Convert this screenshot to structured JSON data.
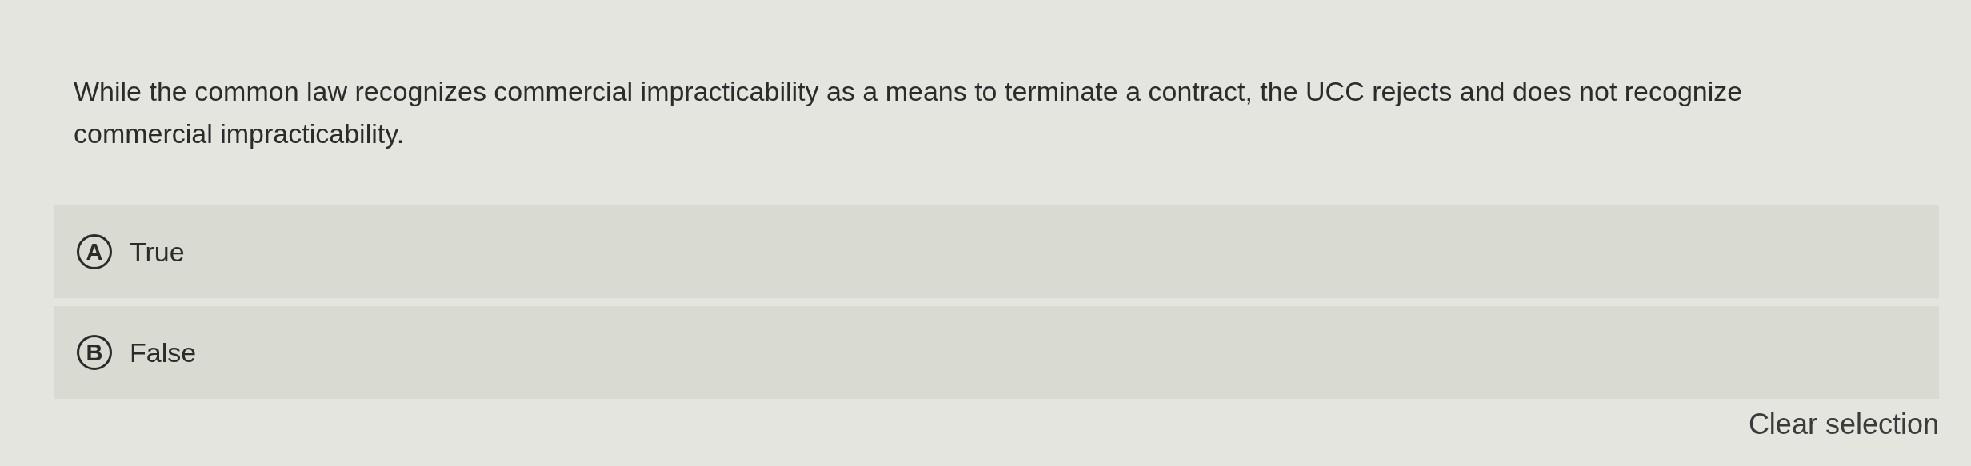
{
  "question": {
    "text": "While the common law recognizes commercial impracticability as a means to terminate a contract, the UCC rejects and does not recognize commercial impracticability."
  },
  "options": [
    {
      "letter": "A",
      "label": "True",
      "selected": false
    },
    {
      "letter": "B",
      "label": "False",
      "selected": false
    }
  ],
  "clear_link": "Clear selection"
}
